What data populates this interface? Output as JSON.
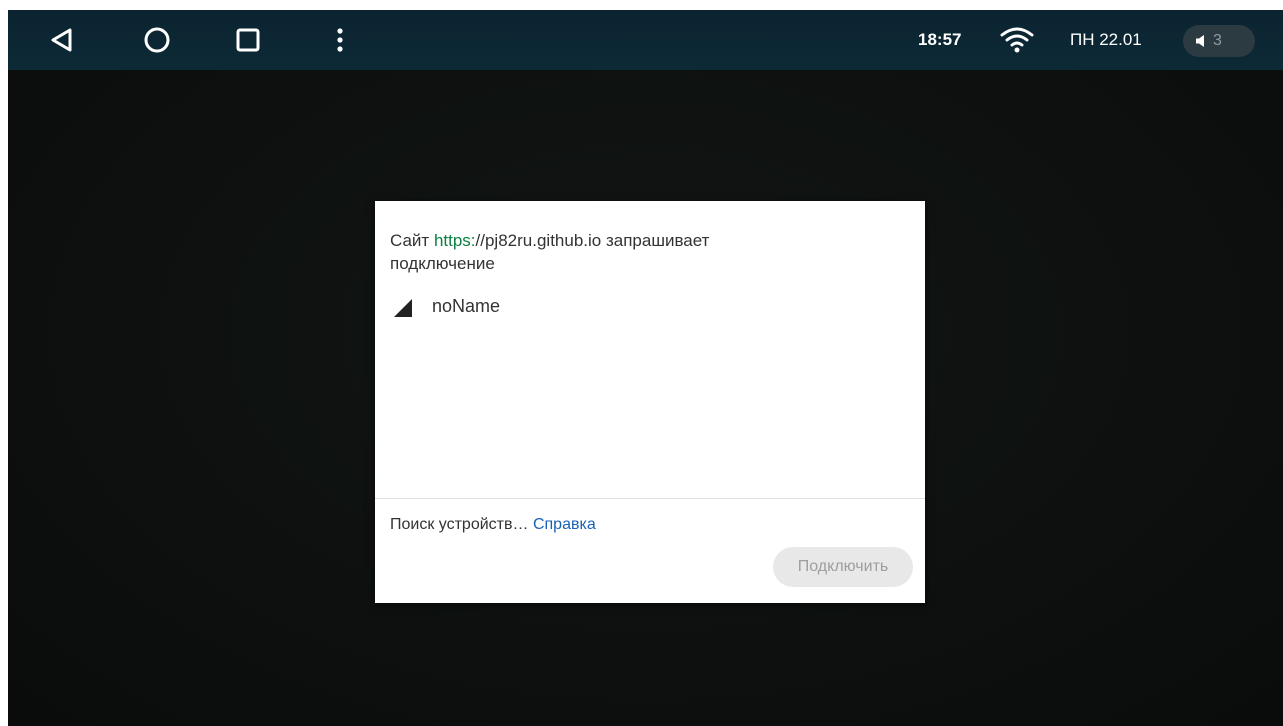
{
  "status_bar": {
    "nav": {
      "back_icon": "back-triangle-icon",
      "home_icon": "home-circle-icon",
      "recents_icon": "recents-square-icon",
      "menu_icon": "overflow-menu-icon"
    },
    "time": "18:57",
    "wifi_icon": "wifi-icon",
    "date": "ПН 22.01",
    "volume_icon": "volume-icon",
    "volume_level": "3"
  },
  "dialog": {
    "title_prefix": "Сайт ",
    "origin_scheme": "https:",
    "origin_host": "//pj82ru.github.io",
    "title_suffix": " запрашивает подключение",
    "devices": [
      {
        "icon": "signal-strength-icon",
        "name": "noName"
      }
    ],
    "status_text": "Поиск устройств…",
    "help_link": "Справка",
    "connect_button": "Подключить"
  },
  "colors": {
    "status_bar_bg": "#0c2a36",
    "background": "#0d100f",
    "origin_scheme": "#0b8043",
    "link": "#1a62b8",
    "disabled_button_bg": "#e8e8e8",
    "disabled_button_text": "#9e9e9e"
  }
}
